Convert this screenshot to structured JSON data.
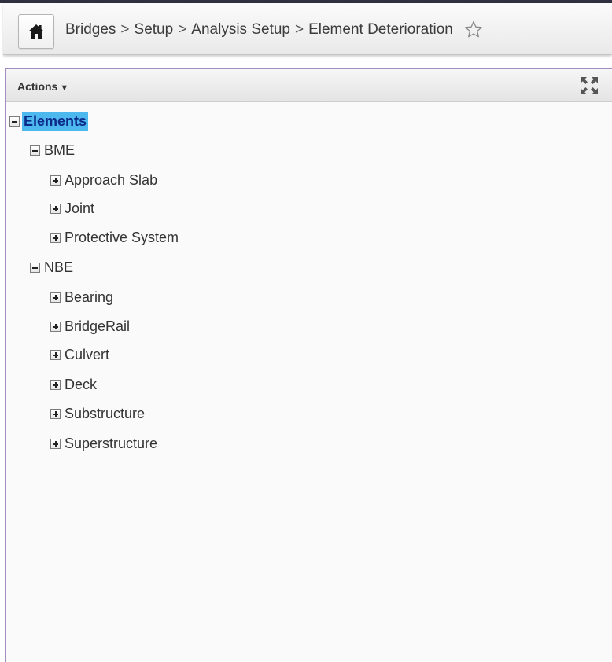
{
  "breadcrumb": {
    "items": [
      "Bridges",
      "Setup",
      "Analysis Setup",
      "Element Deterioration"
    ],
    "separator": ">"
  },
  "icons": {
    "home": "home-icon",
    "favorite": "star-outline-icon",
    "fullscreen": "expand-icon"
  },
  "panel": {
    "actions_label": "Actions",
    "actions_caret": "▼"
  },
  "tree": {
    "root": {
      "label": "Elements",
      "expanded": true,
      "selected": true,
      "children": [
        {
          "label": "BME",
          "expanded": true,
          "children": [
            {
              "label": "Approach Slab",
              "expanded": false
            },
            {
              "label": "Joint",
              "expanded": false
            },
            {
              "label": "Protective System",
              "expanded": false
            }
          ]
        },
        {
          "label": "NBE",
          "expanded": true,
          "children": [
            {
              "label": "Bearing",
              "expanded": false
            },
            {
              "label": "BridgeRail",
              "expanded": false
            },
            {
              "label": "Culvert",
              "expanded": false
            },
            {
              "label": "Deck",
              "expanded": false
            },
            {
              "label": "Substructure",
              "expanded": false
            },
            {
              "label": "Superstructure",
              "expanded": false
            }
          ]
        }
      ]
    }
  },
  "colors": {
    "selection": "#4db8ee",
    "panel_border": "#a48cc2"
  }
}
